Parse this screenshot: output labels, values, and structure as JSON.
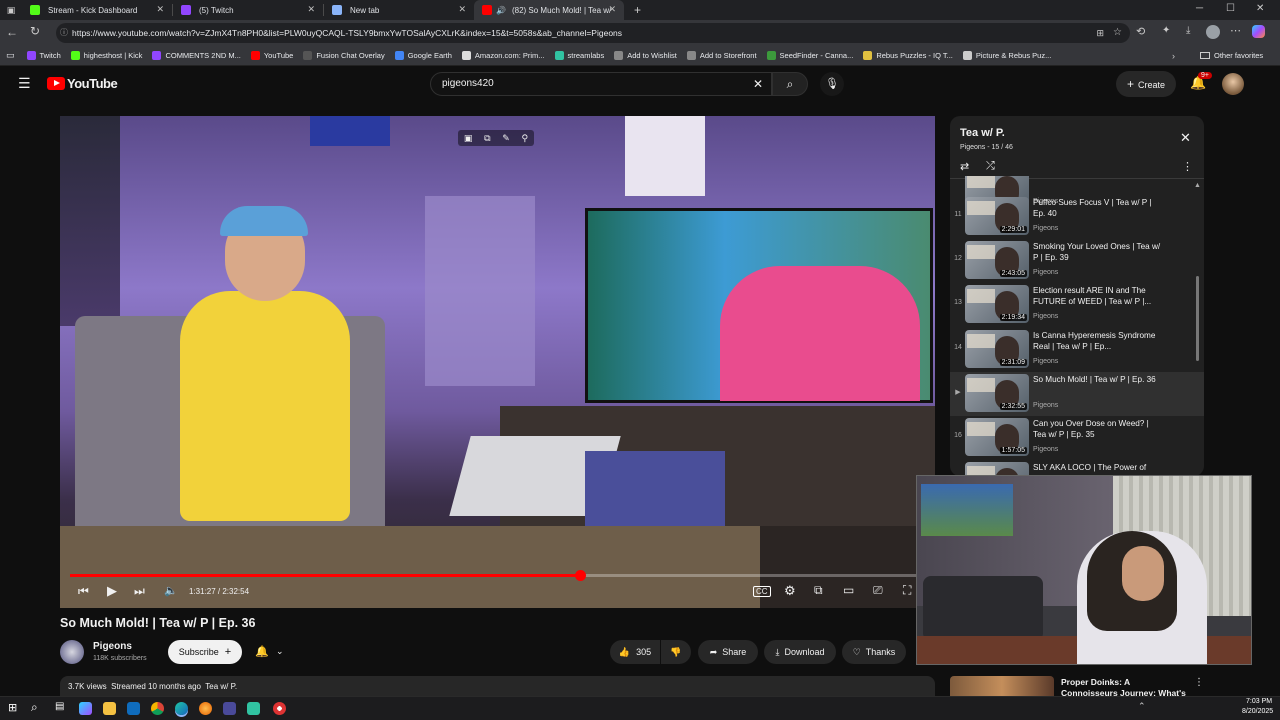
{
  "browser": {
    "tabs": [
      {
        "title": "Stream - Kick Dashboard",
        "color": "#53fc18"
      },
      {
        "title": "(5) Twitch",
        "color": "#9146ff"
      },
      {
        "title": "New tab",
        "color": "#8ab4f8"
      },
      {
        "title": "(82) So Much Mold! | Tea w/",
        "color": "#ff0000"
      }
    ],
    "url": "https://www.youtube.com/watch?v=ZJmX4Tn8PH0&list=PLW0uyQCAQL-TSLY9bmxYwTOSalAyCXLrK&index=15&t=5058s&ab_channel=Pigeons",
    "bookmarks": [
      {
        "label": "Twitch",
        "color": "#9146ff"
      },
      {
        "label": "highesthost | Kick",
        "color": "#53fc18"
      },
      {
        "label": "COMMENTS 2ND M...",
        "color": "#9146ff"
      },
      {
        "label": "YouTube",
        "color": "#ff0000"
      },
      {
        "label": "Fusion Chat Overlay",
        "color": "#555555"
      },
      {
        "label": "Google Earth",
        "color": "#4285f4"
      },
      {
        "label": "Amazon.com: Prim...",
        "color": "#dddddd"
      },
      {
        "label": "streamlabs",
        "color": "#31c3a2"
      },
      {
        "label": "Add to Wishlist",
        "color": "#888888"
      },
      {
        "label": "Add to Storefront",
        "color": "#888888"
      },
      {
        "label": "SeedFinder - Canna...",
        "color": "#3c9a3c"
      },
      {
        "label": "Rebus Puzzles - IQ T...",
        "color": "#e0c040"
      },
      {
        "label": "Picture & Rebus Puz...",
        "color": "#cccccc"
      }
    ],
    "other_favorites": "Other favorites"
  },
  "youtube": {
    "logo_text": "YouTube",
    "search_value": "pigeons420",
    "create_label": "Create",
    "notif_badge": "9+"
  },
  "player": {
    "time": "1:31:27 / 2:32:54",
    "progress": 0.597
  },
  "video": {
    "title": "So Much Mold! | Tea w/ P | Ep. 36",
    "channel": "Pigeons",
    "subscribers": "118K subscribers",
    "subscribe_label": "Subscribe",
    "likes": "305",
    "share_label": "Share",
    "download_label": "Download",
    "thanks_label": "Thanks",
    "meta": "3.7K views  Streamed 10 months ago  Tea w/ P."
  },
  "playlist": {
    "title": "Tea w/ P.",
    "subtitle": "Pigeons - 15 / 46",
    "items": [
      {
        "index": "",
        "title": "",
        "duration": "2:34:07",
        "channel": "Pigeons"
      },
      {
        "index": "11",
        "title": "Puffco Sues Focus V | Tea w/ P | Ep. 40",
        "duration": "2:29:01",
        "channel": "Pigeons"
      },
      {
        "index": "12",
        "title": "Smoking Your Loved Ones | Tea w/ P | Ep. 39",
        "duration": "2:43:05",
        "channel": "Pigeons"
      },
      {
        "index": "13",
        "title": "Election result ARE IN and The FUTURE of WEED | Tea w/ P |...",
        "duration": "2:19:34",
        "channel": "Pigeons"
      },
      {
        "index": "14",
        "title": "Is Canna Hyperemesis Syndrome Real | Tea w/ P | Ep...",
        "duration": "2:31:09",
        "channel": "Pigeons"
      },
      {
        "index": "▶",
        "title": "So Much Mold! | Tea w/ P | Ep. 36",
        "duration": "2:32:55",
        "channel": "Pigeons"
      },
      {
        "index": "16",
        "title": "Can you Over Dose on Weed? | Tea w/ P | Ep. 35",
        "duration": "1:57:05",
        "channel": "Pigeons"
      },
      {
        "index": "",
        "title": "SLY AKA LOCO | The Power of",
        "duration": "",
        "channel": ""
      }
    ]
  },
  "recommended": {
    "title": "Proper Doinks: A Connoisseurs Journey: What's Smoking &..."
  },
  "taskbar": {
    "time": "7:03 PM",
    "date": "8/20/2025"
  }
}
